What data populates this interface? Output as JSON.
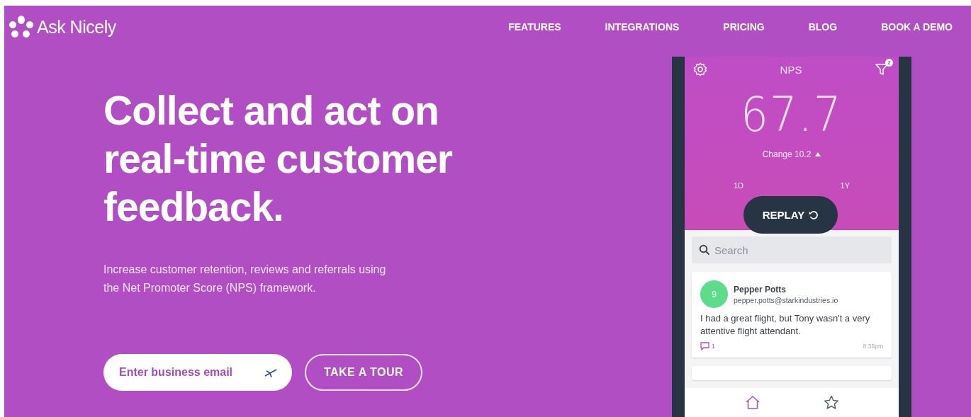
{
  "brand": {
    "name": "Ask Nicely"
  },
  "nav": [
    {
      "label": "FEATURES"
    },
    {
      "label": "INTEGRATIONS"
    },
    {
      "label": "PRICING"
    },
    {
      "label": "BLOG"
    },
    {
      "label": "BOOK A DEMO"
    }
  ],
  "hero": {
    "title": "Collect and act on real-time customer feedback.",
    "subtitle": "Increase customer retention, reviews and referrals using the Net Promoter Score (NPS) framework.",
    "email": {
      "placeholder": "Enter business email"
    },
    "tour_button": "TAKE A TOUR"
  },
  "phone": {
    "title": "NPS",
    "filter_count": "2",
    "score": "67.7",
    "change": "Change 10.2",
    "ranges": [
      {
        "label": "1D"
      },
      {
        "label": "1Y"
      }
    ],
    "replay": "REPLAY",
    "search": {
      "placeholder": "Search"
    },
    "responses": [
      {
        "score": "9",
        "color": "#5ddc8c",
        "name": "Pepper Potts",
        "email": "pepper.potts@starkindustries.io",
        "comment": "I had a great flight, but Tony wasn't a very attentive flight attendant.",
        "comments_count": "1",
        "time": "8:36pm"
      }
    ],
    "tabbar": [
      {
        "kind": "home",
        "selected": true
      },
      {
        "kind": "star",
        "selected": false
      }
    ]
  }
}
